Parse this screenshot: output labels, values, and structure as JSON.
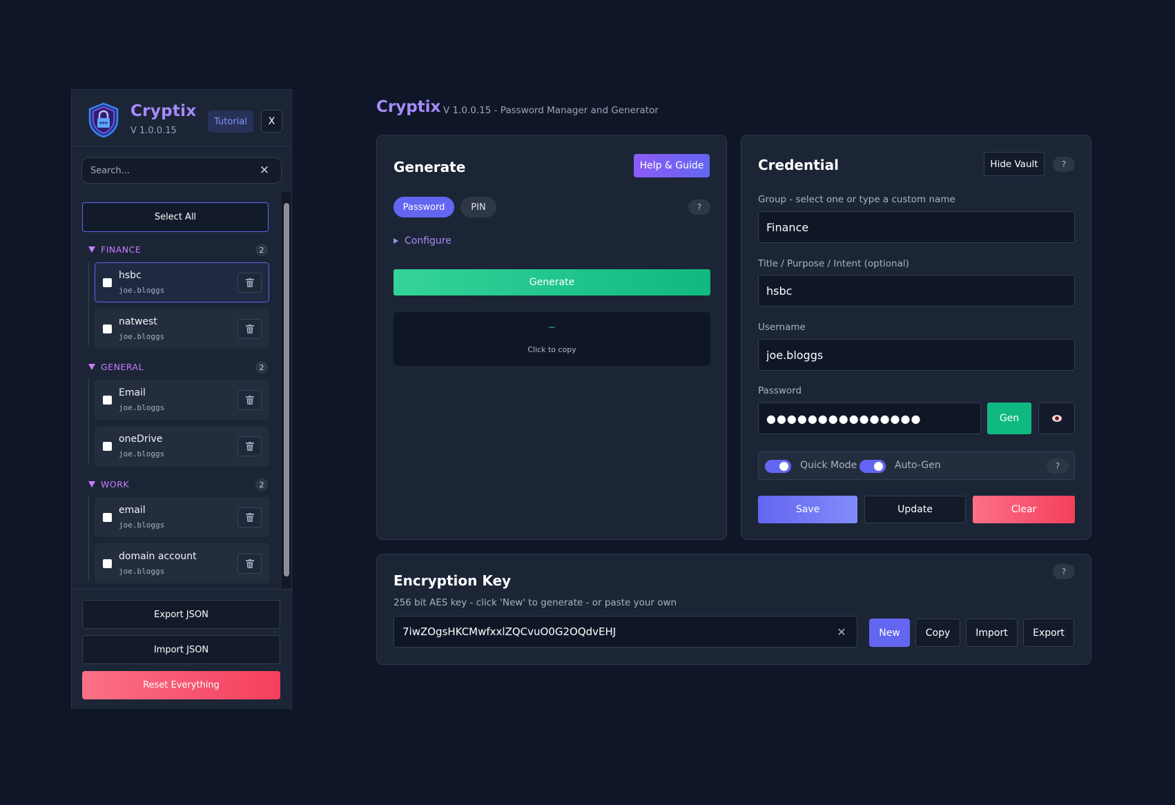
{
  "sidebar": {
    "brand": "Cryptix",
    "version": "V 1.0.0.15",
    "tutorial_label": "Tutorial",
    "close_label": "X",
    "search_placeholder": "Search...",
    "select_all_label": "Select All",
    "groups": [
      {
        "name": "FINANCE",
        "count": "2",
        "entries": [
          {
            "title": "hsbc",
            "user": "joe.bloggs",
            "active": true
          },
          {
            "title": "natwest",
            "user": "joe.bloggs",
            "active": false
          }
        ]
      },
      {
        "name": "GENERAL",
        "count": "2",
        "entries": [
          {
            "title": "Email",
            "user": "joe.bloggs",
            "active": false
          },
          {
            "title": "oneDrive",
            "user": "joe.bloggs",
            "active": false
          }
        ]
      },
      {
        "name": "WORK",
        "count": "2",
        "entries": [
          {
            "title": "email",
            "user": "joe.bloggs",
            "active": false
          },
          {
            "title": "domain account",
            "user": "joe.bloggs",
            "active": false
          }
        ]
      }
    ],
    "export_label": "Export JSON",
    "import_label": "Import JSON",
    "reset_label": "Reset Everything"
  },
  "header": {
    "title": "Cryptix",
    "subtitle": "V 1.0.0.15 - Password Manager and Generator"
  },
  "generate": {
    "title": "Generate",
    "help_label": "Help & Guide",
    "modes": [
      "Password",
      "PIN"
    ],
    "help_q": "?",
    "configure_label": "Configure",
    "generate_label": "Generate",
    "output_value": "–",
    "output_hint": "Click to copy"
  },
  "credential": {
    "title": "Credential",
    "hide_vault_label": "Hide Vault",
    "help_q": "?",
    "group_label": "Group - select one or type a custom name",
    "group_value": "Finance",
    "title_label": "Title / Purpose / Intent (optional)",
    "title_value": "hsbc",
    "username_label": "Username",
    "username_value": "joe.bloggs",
    "password_label": "Password",
    "password_value": "●●●●●●●●●●●●●●●",
    "gen_label": "Gen",
    "quick_mode_label": "Quick Mode",
    "auto_gen_label": "Auto-Gen",
    "quick_mode_on": true,
    "auto_gen_on": true,
    "save_label": "Save",
    "update_label": "Update",
    "clear_label": "Clear"
  },
  "encryption": {
    "title": "Encryption Key",
    "help_q": "?",
    "description": "256 bit AES key - click 'New' to generate - or paste your own",
    "key_value": "7iwZOgsHKCMwfxxlZQCvuO0G2OQdvEHJ",
    "new_label": "New",
    "copy_label": "Copy",
    "import_label": "Import",
    "export_label": "Export"
  }
}
